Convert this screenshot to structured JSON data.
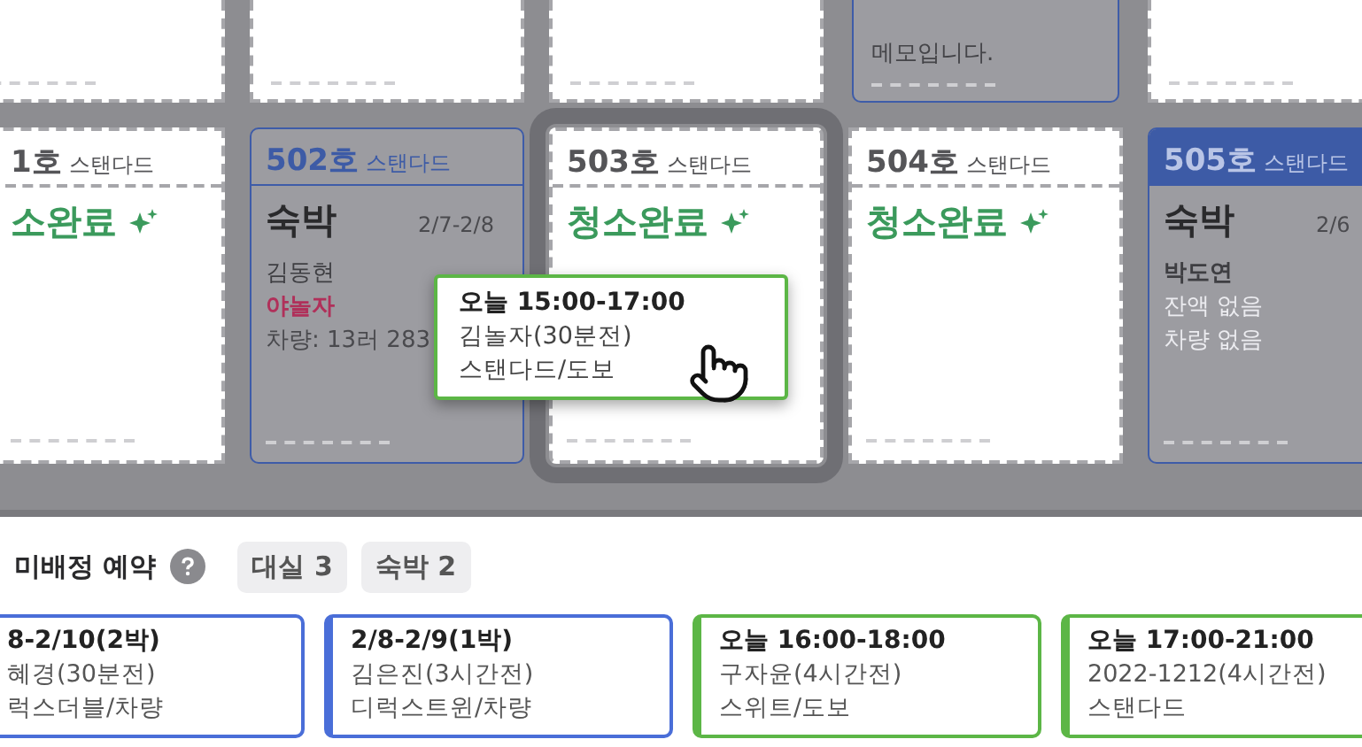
{
  "top_row": [
    {
      "kind": "vacant"
    },
    {
      "kind": "vacant"
    },
    {
      "kind": "vacant"
    },
    {
      "kind": "booked",
      "memo": "메모입니다."
    },
    {
      "kind": "vacant"
    }
  ],
  "rooms": [
    {
      "kind": "vacant",
      "number": "1호",
      "type": "스탠다드",
      "status": "소완료",
      "highlighted": false
    },
    {
      "kind": "booked",
      "number": "502호",
      "type": "스탠다드",
      "header_filled": false,
      "stay": "숙박",
      "dates": "2/7-2/8",
      "guest": "김동현",
      "guest_bold": false,
      "channel": "야놀자",
      "notes": [
        {
          "text": "차량: 13러 283",
          "muted": false
        }
      ]
    },
    {
      "kind": "vacant",
      "number": "503호",
      "type": "스탠다드",
      "status": "청소완료",
      "highlighted": true
    },
    {
      "kind": "vacant",
      "number": "504호",
      "type": "스탠다드",
      "status": "청소완료",
      "highlighted": false
    },
    {
      "kind": "booked",
      "number": "505호",
      "type": "스탠다드",
      "header_filled": true,
      "stay": "숙박",
      "dates": "2/6",
      "guest": "박도연",
      "guest_bold": true,
      "notes": [
        {
          "text": "잔액 없음",
          "muted": true
        },
        {
          "text": "차량 없음",
          "muted": true
        }
      ]
    }
  ],
  "drag_card": {
    "time": "오늘 15:00-17:00",
    "guest": "김놀자(30분전)",
    "detail": "스탠다드/도보"
  },
  "unassigned": {
    "title": "미배정 예약",
    "chips": [
      {
        "label": "대실 3"
      },
      {
        "label": "숙박 2"
      }
    ],
    "reservations": [
      {
        "kind": "stay",
        "title": "8-2/10(2박)",
        "guest": "혜경(30분전)",
        "detail": "럭스더블/차량"
      },
      {
        "kind": "stay",
        "title": "2/8-2/9(1박)",
        "guest": "김은진(3시간전)",
        "detail": "디럭스트윈/차량"
      },
      {
        "kind": "dayuse",
        "title": "오늘 16:00-18:00",
        "guest": "구자윤(4시간전)",
        "detail": "스위트/도보"
      },
      {
        "kind": "dayuse",
        "title": "오늘 17:00-21:00",
        "guest": "2022-1212(4시간전)",
        "detail": "스탠다드"
      }
    ]
  }
}
